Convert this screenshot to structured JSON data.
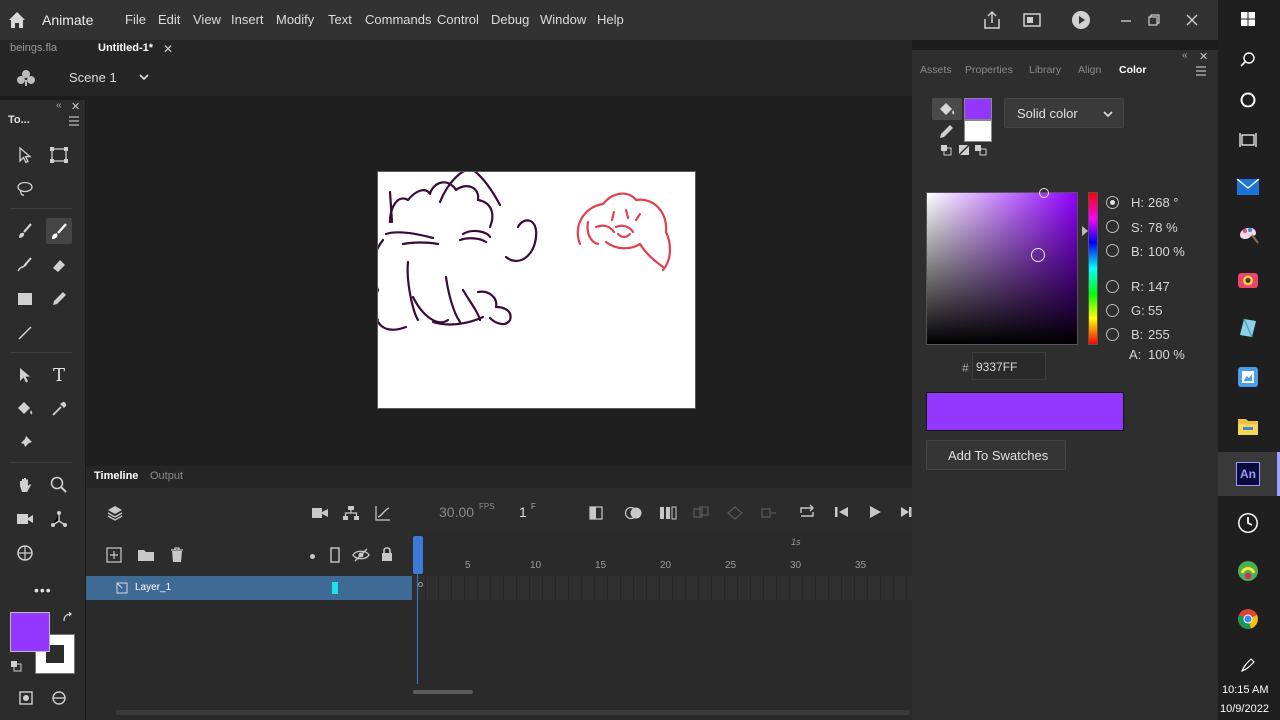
{
  "menubar": {
    "app_name": "Animate",
    "items": [
      "File",
      "Edit",
      "View",
      "Insert",
      "Modify",
      "Text",
      "Commands",
      "Control",
      "Debug",
      "Window",
      "Help"
    ]
  },
  "doc_tabs": [
    {
      "label": "beings.fla",
      "active": false
    },
    {
      "label": "Untitled-1*",
      "active": true
    }
  ],
  "editbar": {
    "scene": "Scene 1"
  },
  "toolbar": {
    "title": "To..."
  },
  "timeline": {
    "tabs": [
      "Timeline",
      "Output"
    ],
    "fps": "30.00",
    "fps_unit": "FPS",
    "frame": "1",
    "frame_unit": "F",
    "ruler_second_label": "1s",
    "ruler_labels": [
      "5",
      "10",
      "15",
      "20",
      "25",
      "30",
      "35"
    ],
    "layers": [
      {
        "name": "Layer_1"
      }
    ]
  },
  "right_panel": {
    "tabs": [
      "Assets",
      "Properties",
      "Library",
      "Align",
      "Color"
    ],
    "active_tab": "Color",
    "fill_type": "Solid color",
    "hsb": {
      "h_label": "H:",
      "h": "268 °",
      "s_label": "S:",
      "s": "78 %",
      "b_label": "B:",
      "b": "100 %"
    },
    "rgb": {
      "r_label": "R:",
      "r": "147",
      "g_label": "G:",
      "g": "55",
      "b_label": "B:",
      "b": "255"
    },
    "alpha_label": "A:",
    "alpha": "100 %",
    "hex_prefix": "#",
    "hex": "9337FF",
    "add_swatch_label": "Add To Swatches"
  },
  "colors": {
    "fill": "#9337FF",
    "stroke": "#FFFFFF",
    "drawing_dark": "#3a0a3a",
    "drawing_red": "#e0404f"
  },
  "taskbar": {
    "time": "10:15 AM",
    "date": "10/9/2022",
    "icons": [
      "windows-icon",
      "search-icon",
      "cortana-icon",
      "task-view-icon",
      "mail-icon",
      "paint-icon",
      "camera-icon",
      "sketch-icon",
      "photos-icon",
      "file-explorer-icon",
      "animate-icon",
      "clock-icon",
      "app-icon",
      "chrome-icon",
      "pen-icon"
    ]
  }
}
